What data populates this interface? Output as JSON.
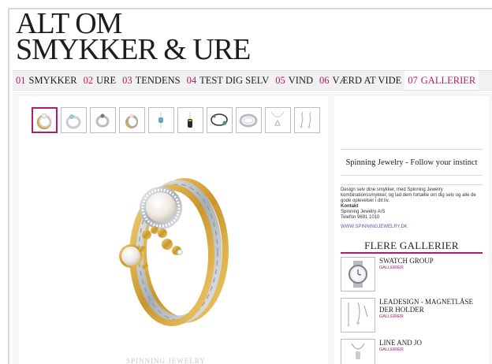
{
  "site": {
    "logo_line1": "ALT OM",
    "logo_line2": "SMYKKER & URE"
  },
  "nav": {
    "items": [
      {
        "num": "01",
        "label": "SMYKKER"
      },
      {
        "num": "02",
        "label": "URE"
      },
      {
        "num": "03",
        "label": "TENDENS"
      },
      {
        "num": "04",
        "label": "TEST DIG SELV"
      },
      {
        "num": "05",
        "label": "VIND"
      },
      {
        "num": "06",
        "label": "VÆRD AT VIDE"
      },
      {
        "num": "07",
        "label": "GALLERIER"
      }
    ],
    "active_index": 6
  },
  "gallery": {
    "thumbnails": [
      "ring-icon",
      "ring-icon",
      "ring-icon",
      "ring-icon",
      "bead-icon",
      "charm-icon",
      "bracelet-icon",
      "ring-icon",
      "necklace-icon",
      "earrings-icon"
    ],
    "active_index": 0,
    "caption": "SPINNING JEWELRY"
  },
  "sidebar": {
    "title": "Spinning Jewelry - Follow your instinct",
    "description": "Design selv dine smykker, med Spinning Jewelry kombinationssmykker, og lad dem fortælle om dig selv og alle de gode oplevelser i dit liv.",
    "contact_heading": "Kontakt",
    "contact_name": "Spinning Jewelry A/S",
    "contact_phone": "Telefon 9691 1010",
    "link": "WWW.SPINNINGJEWELRY.DK",
    "more_title": "FLERE GALLERIER",
    "galleries": [
      {
        "name": "SWATCH GROUP",
        "sub": "GALLERIER",
        "icon": "watch-icon"
      },
      {
        "name": "LEADESIGN - MAGNETLÅSE DER HOLDER",
        "sub": "GALLERIER",
        "icon": "necklace-icon"
      },
      {
        "name": "LINE AND JO",
        "sub": "GALLERIER",
        "icon": "pendant-icon"
      }
    ]
  },
  "colors": {
    "accent": "#b01b6b",
    "link": "#5a5aa8",
    "gold": "#d4a63c",
    "silver": "#c9cdd2"
  }
}
